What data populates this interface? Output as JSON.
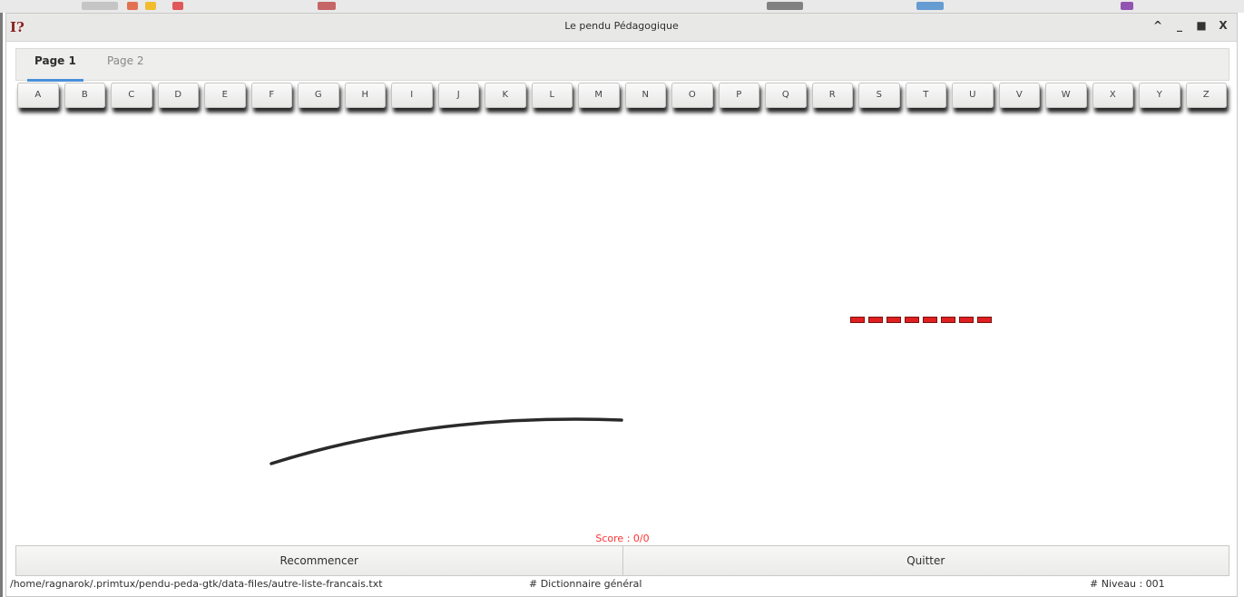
{
  "window": {
    "title": "Le pendu Pédagogique",
    "controls": [
      "^",
      "_",
      "■",
      "X"
    ]
  },
  "tabs": [
    {
      "label": "Page 1",
      "active": true
    },
    {
      "label": "Page 2",
      "active": false
    }
  ],
  "letters": [
    "A",
    "B",
    "C",
    "D",
    "E",
    "F",
    "G",
    "H",
    "I",
    "J",
    "K",
    "L",
    "M",
    "N",
    "O",
    "P",
    "Q",
    "R",
    "S",
    "T",
    "U",
    "V",
    "W",
    "X",
    "Y",
    "Z"
  ],
  "hidden_word_length": 8,
  "score": "Score : 0/0",
  "buttons": {
    "restart": "Recommencer",
    "quit": "Quitter"
  },
  "status": {
    "path": "/home/ragnarok/.primtux/pendu-peda-gtk/data-files/autre-liste-francais.txt",
    "dictionary": "# Dictionnaire général",
    "level": "# Niveau : 001"
  },
  "colors": {
    "score": "#ff3030",
    "word_placeholder": "#e02020",
    "active_tab": "#4a90d9"
  }
}
